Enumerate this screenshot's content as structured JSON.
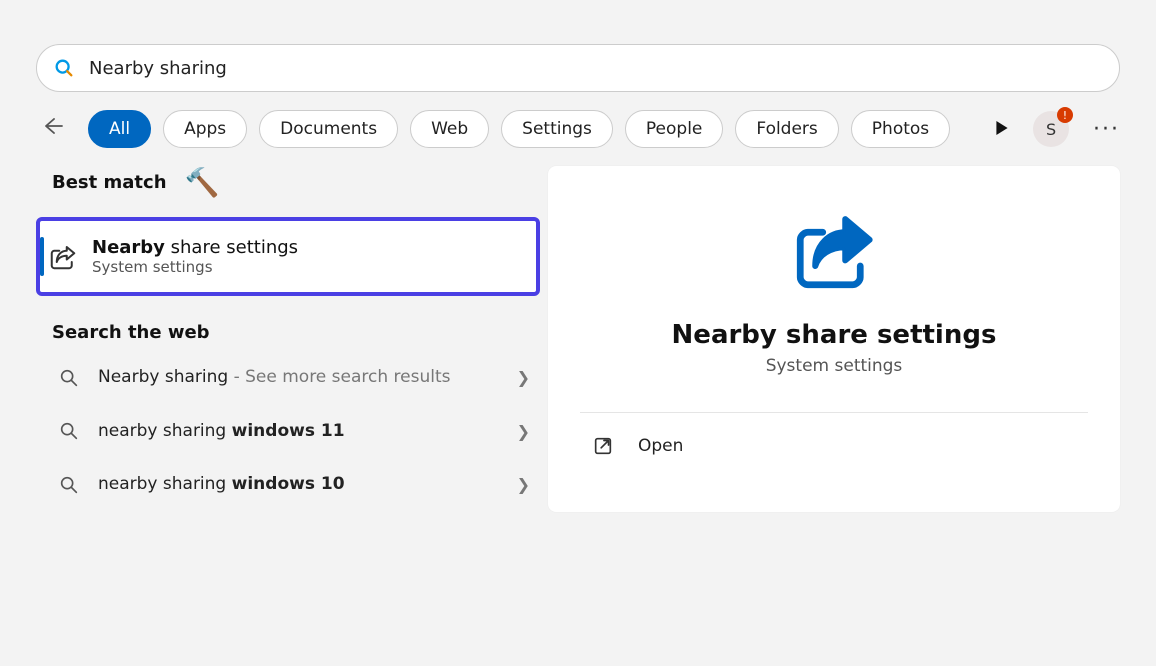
{
  "search": {
    "value": "Nearby sharing"
  },
  "filters": {
    "all": "All",
    "apps": "Apps",
    "documents": "Documents",
    "web": "Web",
    "settings": "Settings",
    "people": "People",
    "folders": "Folders",
    "photos": "Photos"
  },
  "avatar": {
    "initial": "S",
    "badge": "!"
  },
  "left": {
    "best_match_label": "Best match",
    "result": {
      "title_bold": "Nearby",
      "title_rest": " share settings",
      "subtitle": "System settings"
    },
    "web_label": "Search the web",
    "web_items": [
      {
        "main": "Nearby sharing",
        "suffix": " - See more search results",
        "bold_suffix": ""
      },
      {
        "main": "nearby sharing ",
        "suffix": "",
        "bold_suffix": "windows 11"
      },
      {
        "main": "nearby sharing ",
        "suffix": "",
        "bold_suffix": "windows 10"
      }
    ]
  },
  "right": {
    "title": "Nearby share settings",
    "subtitle": "System settings",
    "open_label": "Open"
  }
}
